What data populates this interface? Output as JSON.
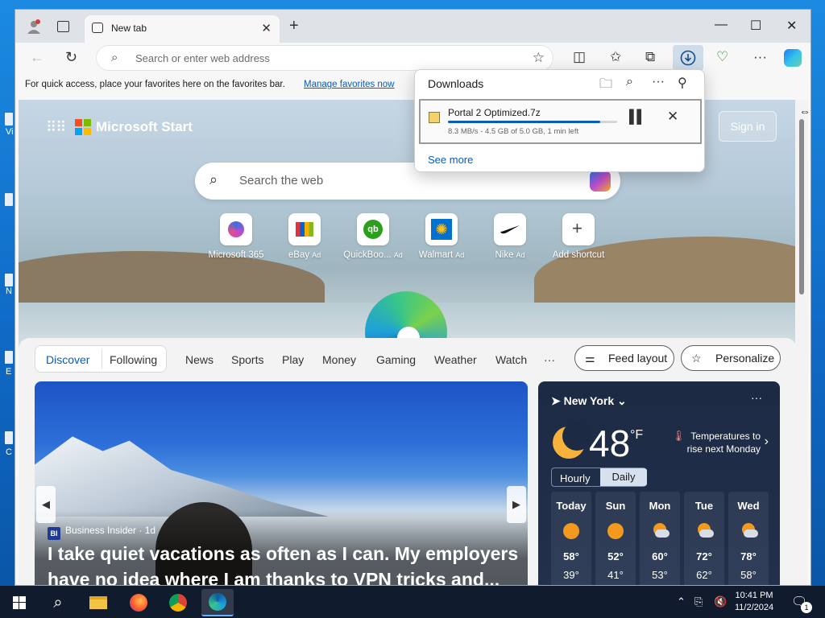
{
  "browser": {
    "tab_title": "New tab",
    "address_placeholder": "Search or enter web address",
    "favorites_bar_text": "For quick access, place your favorites here on the favorites bar.",
    "favorites_bar_link": "Manage favorites now"
  },
  "downloads": {
    "title": "Downloads",
    "item": {
      "name": "Portal 2 Optimized.7z",
      "status": "8.3 MB/s - 4.5 GB of 5.0 GB, 1 min left",
      "progress": 0.9
    },
    "see_more": "See more"
  },
  "start": {
    "brand": "Microsoft Start",
    "sign_in": "Sign in",
    "search_placeholder": "Search the web",
    "shortcuts": [
      {
        "label": "Microsoft 365",
        "ad": ""
      },
      {
        "label": "eBay",
        "ad": "Ad"
      },
      {
        "label": "QuickBoo...",
        "ad": "Ad"
      },
      {
        "label": "Walmart",
        "ad": "Ad"
      },
      {
        "label": "Nike",
        "ad": "Ad"
      },
      {
        "label": "Add shortcut",
        "ad": ""
      }
    ],
    "feed_tabs": {
      "discover": "Discover",
      "following": "Following"
    },
    "categories": [
      "News",
      "Sports",
      "Play",
      "Money",
      "Gaming",
      "Weather",
      "Watch",
      "···"
    ],
    "feed_layout": "Feed layout",
    "personalize": "Personalize"
  },
  "news": {
    "source": "Business Insider · 1d",
    "source_badge": "BI",
    "headline": "I take quiet vacations as often as I can. My employers have no idea where I am thanks to VPN tricks and..."
  },
  "weather": {
    "location": "New York",
    "temp": "48",
    "unit": "°F",
    "alert": "Temperatures to rise next Monday",
    "hourly": "Hourly",
    "daily": "Daily",
    "days": [
      {
        "name": "Today",
        "hi": "58°",
        "lo": "39°",
        "icon": "sun"
      },
      {
        "name": "Sun",
        "hi": "52°",
        "lo": "41°",
        "icon": "sun"
      },
      {
        "name": "Mon",
        "hi": "60°",
        "lo": "53°",
        "icon": "partly-cloudy"
      },
      {
        "name": "Tue",
        "hi": "72°",
        "lo": "62°",
        "icon": "partly-cloudy"
      },
      {
        "name": "Wed",
        "hi": "78°",
        "lo": "58°",
        "icon": "partly-cloudy"
      }
    ]
  },
  "taskbar": {
    "time": "10:41 PM",
    "date": "11/2/2024",
    "notification_count": "1"
  },
  "desktop": {
    "icon_letters": [
      "Vi",
      "N",
      "E",
      "C"
    ]
  },
  "colors": {
    "accent": "#0a5cb8",
    "taskbar": "#101b2e",
    "weather_bg": "#1c2a44"
  }
}
